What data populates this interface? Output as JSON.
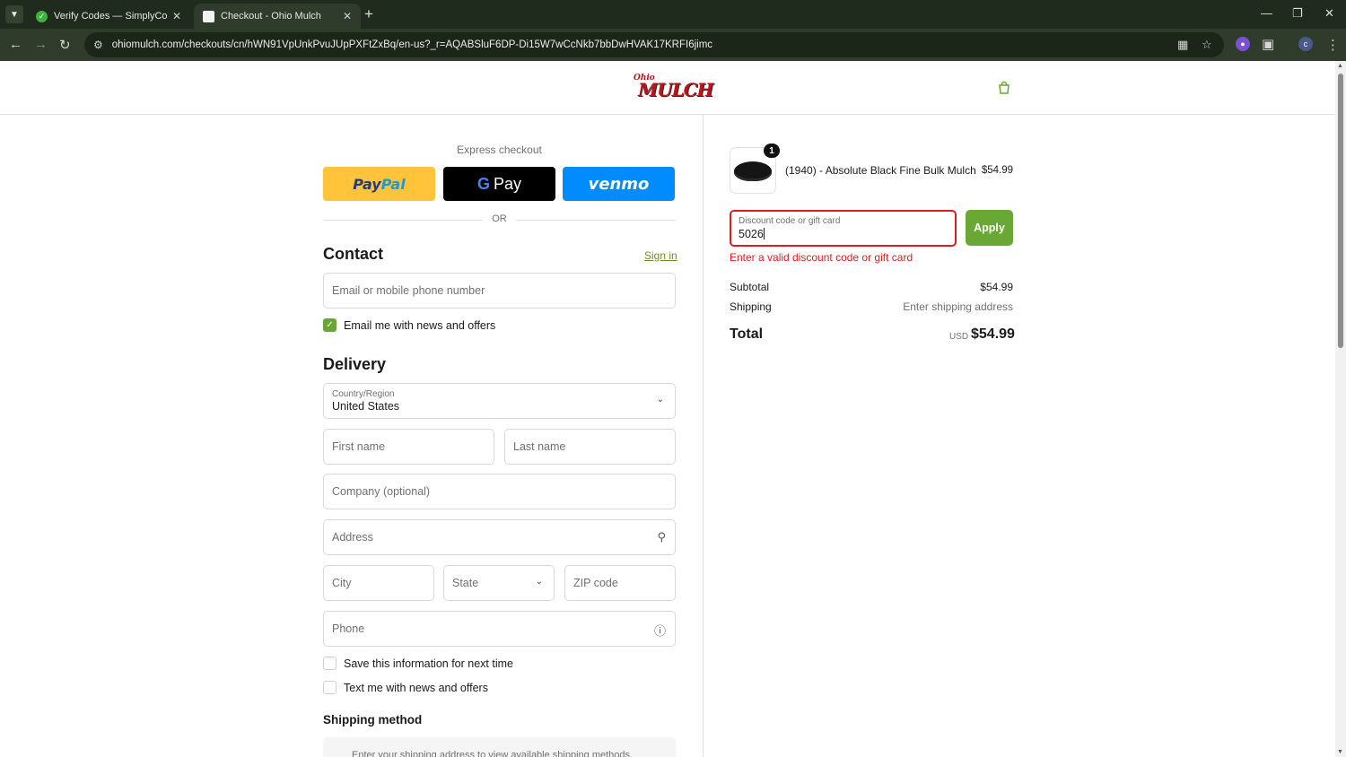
{
  "browser": {
    "tabs": [
      {
        "title": "Verify Codes — SimplyCodes",
        "icon": "simplycodes-check-icon"
      },
      {
        "title": "Checkout - Ohio Mulch",
        "icon": "page-icon"
      }
    ],
    "url": "ohiomulch.com/checkouts/cn/hWN91VpUnkPvuJUpPXFtZxBq/en-us?_r=AQABSluF6DP-Di15W7wCcNkb7bbDwHVAK17KRFI6jimc",
    "profile_initial": "c"
  },
  "header": {
    "logo_small": "Ohio",
    "logo_big": "MULCH"
  },
  "express": {
    "label": "Express checkout",
    "paypal_a": "Pay",
    "paypal_b": "Pal",
    "gpay": "Pay",
    "gpay_g": "G",
    "venmo": "venmo",
    "or": "OR"
  },
  "contact": {
    "title": "Contact",
    "signin": "Sign in",
    "email_placeholder": "Email or mobile phone number",
    "news_label": "Email me with news and offers",
    "news_checked": true
  },
  "delivery": {
    "title": "Delivery",
    "country_label": "Country/Region",
    "country_value": "United States",
    "first_name": "First name",
    "last_name": "Last name",
    "company": "Company (optional)",
    "address": "Address",
    "city": "City",
    "state": "State",
    "zip": "ZIP code",
    "phone": "Phone",
    "save_info": "Save this information for next time",
    "text_me": "Text me with news and offers"
  },
  "shipping": {
    "title": "Shipping method",
    "note": "Enter your shipping address to view available shipping methods."
  },
  "summary": {
    "item": {
      "qty": "1",
      "name": "(1940) - Absolute Black Fine Bulk Mulch",
      "price": "$54.99"
    },
    "discount_label": "Discount code or gift card",
    "discount_value": "5026",
    "apply": "Apply",
    "error": "Enter a valid discount code or gift card",
    "subtotal_label": "Subtotal",
    "subtotal_value": "$54.99",
    "shipping_label": "Shipping",
    "shipping_value": "Enter shipping address",
    "total_label": "Total",
    "currency": "USD",
    "total_value": "$54.99"
  },
  "colors": {
    "accent_green": "#69a834",
    "error_red": "#dd1d1d",
    "paypal_yellow": "#ffc439",
    "venmo_blue": "#008cff"
  }
}
